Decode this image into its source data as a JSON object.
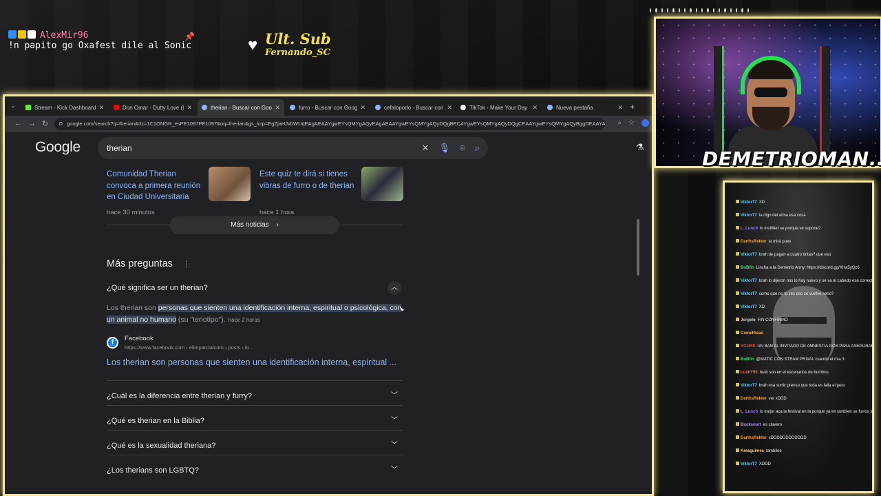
{
  "overlay": {
    "chat_user": "AlexMir96",
    "chat_message": "!n papito go Oxafest dile al Sonic",
    "last_sub_label": "Ult. Sub",
    "last_sub_name": "Fernando_SC",
    "streamer_name": "DEMETRIOMAN..."
  },
  "browser": {
    "tabs": [
      {
        "label": "Stream - Kick Dashboard",
        "color": "#53fc18"
      },
      {
        "label": "Don Omar - Dutty Love (Ly",
        "color": "#ff0000"
      },
      {
        "label": "therian - Buscar con Google",
        "color": "#8ab4f8"
      },
      {
        "label": "furro - Buscar con Google",
        "color": "#8ab4f8"
      },
      {
        "label": "cefalopodo - Buscar con Goog",
        "color": "#8ab4f8"
      },
      {
        "label": "TikTok - Make Your Day",
        "color": "#ffffff"
      },
      {
        "label": "Nueva pestaña",
        "color": "#8ab4f8"
      }
    ],
    "url": "google.com/search?q=therian&rlz=1C1ONGR_esPE1097PE1097&oq=therian&gs_lcrp=EgZjaHJvbWUqEAgAEAAYgwEYsQMYgAQyEAgAEAAYgwEYsQMYgAQyDQgBEC4YgwEYsQMYgAQyDQgCEAAYgwEYsQMYgAQyBggDEAAYAzIGC..."
  },
  "search": {
    "logo": "Google",
    "query": "therian"
  },
  "news": [
    {
      "title": "Comunidad Therian convoca a primera reunión en Ciudad Universitaria",
      "time": "hace 30 minutos"
    },
    {
      "title": "Este quiz te dirá si tienes vibras de furro o de therian",
      "time": "hace 1 hora"
    }
  ],
  "more_news": "Más noticias",
  "paa": {
    "title": "Más preguntas",
    "expanded_question": "¿Qué significa ser un therian?",
    "answer_prefix": "Los therian son ",
    "answer_highlight": "personas que sienten una identificación interna, espiritual o psicológica, con un animal no humano",
    "answer_suffix": " (su \"teriotipo\").",
    "answer_ago": "hace 2 horas",
    "source_name": "Facebook",
    "source_cite": "https://www.facebook.com › elimparcialcom › posts › lo...",
    "source_link": "Los therian son personas que sienten una identificación interna, espiritual ...",
    "questions": [
      "¿Cuál es la diferencia entre therian y furry?",
      "¿Qué es therian en la Biblia?",
      "¿Qué es la sexualidad theriana?",
      "¿Los therians son LGBTQ?"
    ]
  },
  "chat": [
    {
      "user": "ViktorT7",
      "color": "#4fd1ff",
      "msg": "XD"
    },
    {
      "user": "ViktorT7",
      "color": "#4fd1ff",
      "msg": "la digo del alma esa cosa"
    },
    {
      "user": "L_Lunch",
      "color": "#9f7bff",
      "msg": "lo multifed se porque se supone?"
    },
    {
      "user": "DarthsRekter",
      "color": "#ff9f2f",
      "msg": "la mirá pues"
    },
    {
      "user": "ViktorT7",
      "color": "#4fd1ff",
      "msg": "brah de pagan a cuatro tiritas? que eso"
    },
    {
      "user": "BoBfin",
      "color": "#36e36a",
      "msg": "Lincha a la Demetrio Army: https://discord.gg/XHa5yQz6"
    },
    {
      "user": "ViktorT7",
      "color": "#4fd1ff",
      "msg": "brah lo dijeron nos lo hay nuevo y se va al cabedo esa correcto de mucho monos de dinofel"
    },
    {
      "user": "ViktorT7",
      "color": "#4fd1ff",
      "msg": "como que no lo ves eso se vuelve serio?"
    },
    {
      "user": "ViktorT7",
      "color": "#4fd1ff",
      "msg": "XD"
    },
    {
      "user": "Jorgelo",
      "color": "#cfcfcf",
      "msg": "FIN CONFIRMO"
    },
    {
      "user": "ComeRisas",
      "color": "#ffb347",
      "msg": ""
    },
    {
      "user": "YOURE",
      "color": "#ff4444",
      "msg": "UN BAN AL INVITADO DE AMNESTIA GOS PARA ASEGURARSE TODO EL SHOW ESTA ACA VAMOS A TIRAR PINTURAS EN ESE SHOW, ANUNCIAMOS"
    },
    {
      "user": "BoBfin",
      "color": "#36e36a",
      "msg": "@MATIC CON STEAM PRIVAL cuando el mia 3"
    },
    {
      "user": "LuckY55",
      "color": "#ff6b6b",
      "msg": "brah son en el escenarios de bumbos"
    },
    {
      "user": "ViktorT7",
      "color": "#4fd1ff",
      "msg": "brah esa sonic prenso que toda es falla el peru"
    },
    {
      "user": "DarthsRekter",
      "color": "#ff9f2f",
      "msg": "ver xDDD"
    },
    {
      "user": "L_Lunch",
      "color": "#9f7bff",
      "msg": "lo mejor aca la festival en la porque ya en tambien se furros sospensa"
    },
    {
      "user": "Bucksnort",
      "color": "#b98cff",
      "msg": "es clavero"
    },
    {
      "user": "DarthsRekter",
      "color": "#ff9f2f",
      "msg": "xDDDDDDDDDDDD"
    },
    {
      "user": "Amaguimes",
      "color": "#ffd166",
      "msg": "tambilee"
    },
    {
      "user": "ViktorT7",
      "color": "#4fd1ff",
      "msg": "XDDD"
    }
  ]
}
